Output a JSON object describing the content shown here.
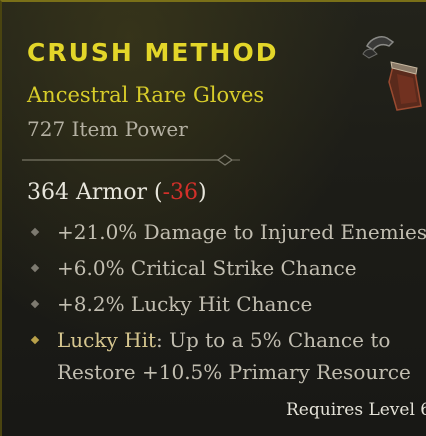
{
  "item": {
    "name": "CRUSH METHOD",
    "rarity_type": "Ancestral Rare Gloves",
    "item_power": "727 Item Power",
    "armor": {
      "label": "364 Armor",
      "open": "(",
      "delta": "-36",
      "close": ")"
    },
    "affixes": [
      {
        "text": "+21.0% Damage to Injured Enemies"
      },
      {
        "text": "+6.0% Critical Strike Chance"
      },
      {
        "text": "+8.2% Lucky Hit Chance"
      }
    ],
    "special": {
      "name": "Lucky Hit",
      "line1": ": Up to a 5% Chance to",
      "line2": "Restore +10.5% Primary Resource"
    },
    "requirement": "Requires Level 6"
  },
  "icons": {
    "item_image": "gloves-icon",
    "bullet": "diamond-bullet-icon",
    "divider": "ornament-divider"
  },
  "colors": {
    "title": "#e3d629",
    "rarity": "#d8cd2a",
    "negative": "#d3302a",
    "special_name": "#d6c68f",
    "text": "#c2beb1"
  }
}
